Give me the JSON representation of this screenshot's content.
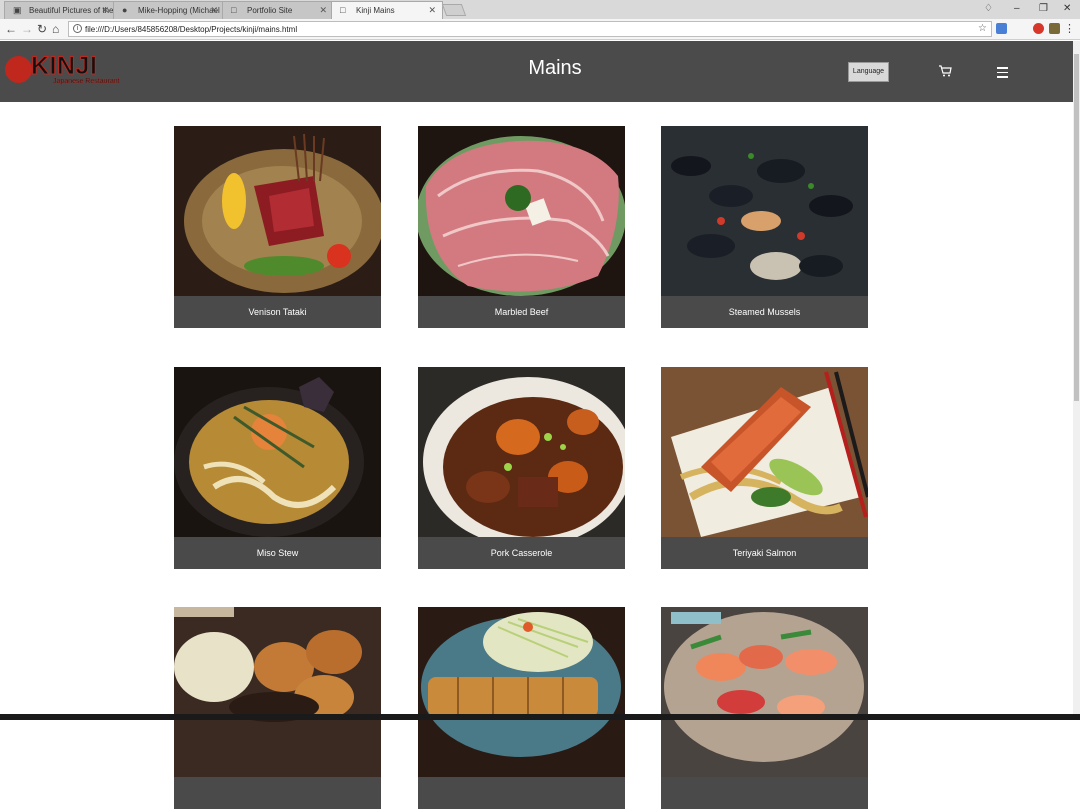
{
  "browser": {
    "tabs": [
      {
        "title": "Beautiful Pictures of the",
        "icon": "camera-icon",
        "active": false
      },
      {
        "title": "Mike-Hopping (Michael",
        "icon": "github-icon",
        "active": false
      },
      {
        "title": "Portfolio Site",
        "icon": "page-icon",
        "active": false
      },
      {
        "title": "Kinji Mains",
        "icon": "page-icon",
        "active": true
      }
    ],
    "url": "file:///D:/Users/845856208/Desktop/Projects/kinji/mains.html"
  },
  "header": {
    "logo_word": "KINJI",
    "logo_sub": "Japanese Restaurant",
    "title": "Mains",
    "language_label": "Language"
  },
  "menu": [
    {
      "name": "Venison Tataki"
    },
    {
      "name": "Marbled Beef"
    },
    {
      "name": "Steamed Mussels"
    },
    {
      "name": "Miso Stew"
    },
    {
      "name": "Pork Casserole"
    },
    {
      "name": "Teriyaki Salmon"
    },
    {
      "name": ""
    },
    {
      "name": ""
    },
    {
      "name": ""
    }
  ],
  "colors": {
    "header_bg": "#4b4b4b",
    "logo_red": "#c0271d",
    "caption_bg": "#4a4a4a"
  }
}
